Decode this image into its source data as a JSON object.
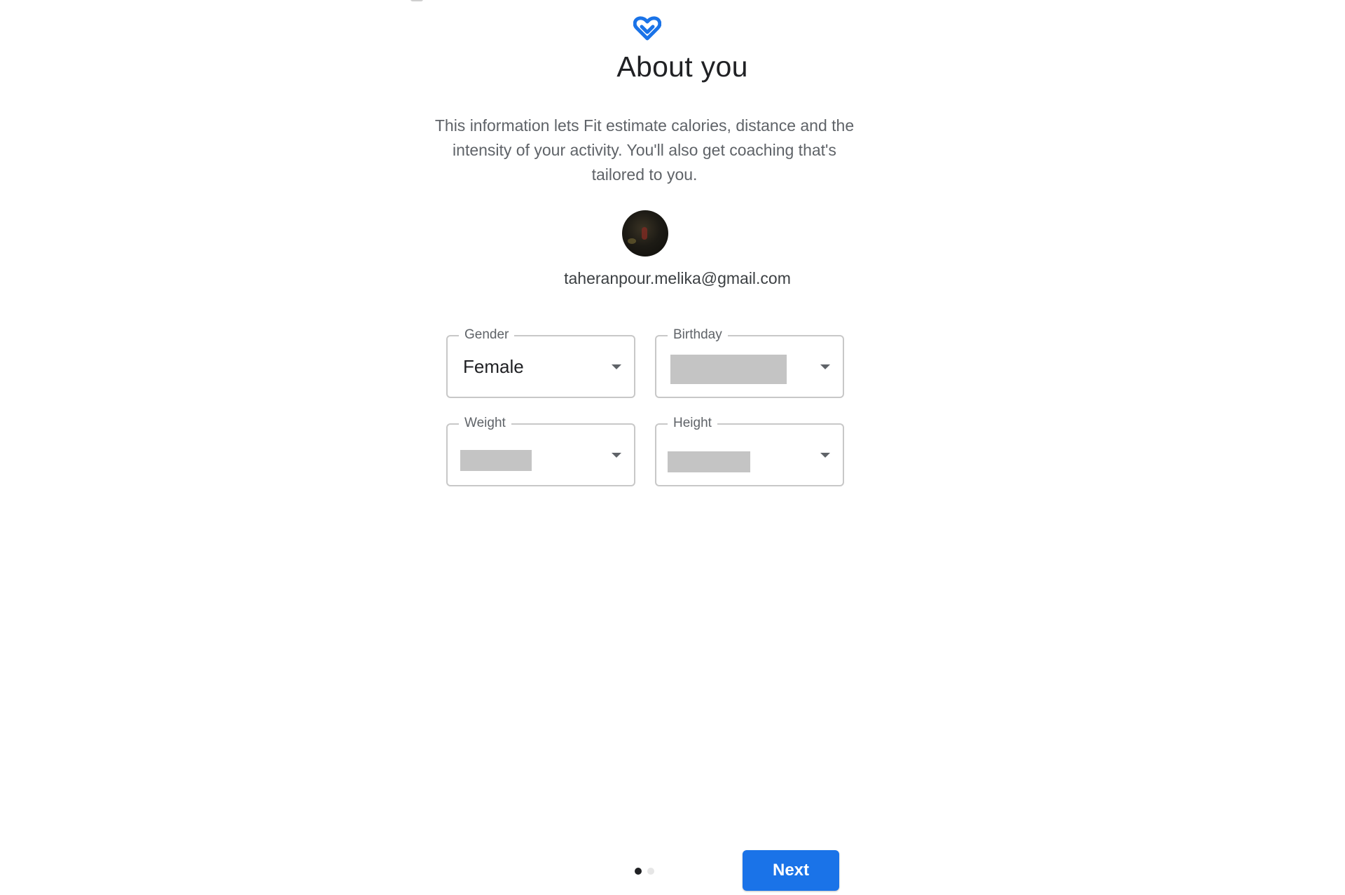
{
  "header": {
    "logo_icon": "google-fit-heart-icon",
    "logo_color": "#1a73e8",
    "title": "About you"
  },
  "intro": {
    "description": "This information lets Fit estimate calories, distance and the intensity of your activity. You'll also get coaching that's tailored to you."
  },
  "account": {
    "avatar_icon": "profile-photo",
    "email": "taheranpour.melika@gmail.com"
  },
  "form": {
    "gender": {
      "label": "Gender",
      "value": "Female"
    },
    "birthday": {
      "label": "Birthday",
      "value": ""
    },
    "weight": {
      "label": "Weight",
      "value": ""
    },
    "height": {
      "label": "Height",
      "value": ""
    }
  },
  "pager": {
    "current_page": 1,
    "total_pages": 2
  },
  "footer": {
    "next_label": "Next",
    "accent_color": "#1a73e8"
  }
}
